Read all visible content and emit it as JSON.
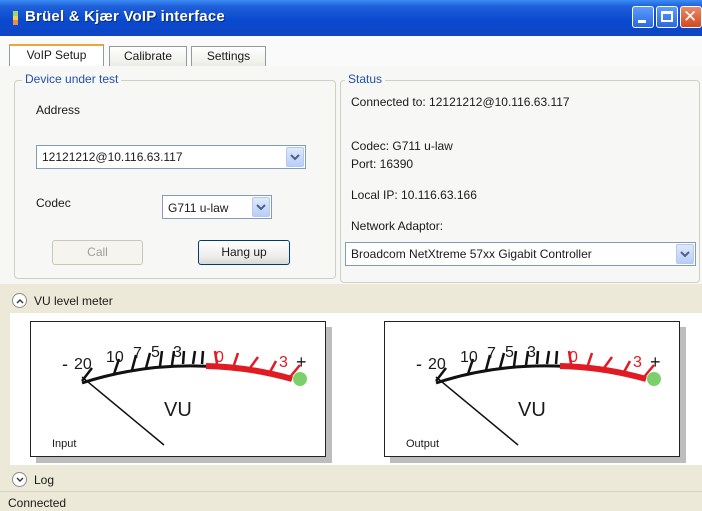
{
  "window": {
    "title": "Brüel & Kjær VoIP interface"
  },
  "tabs": [
    {
      "label": "VoIP Setup",
      "active": true
    },
    {
      "label": "Calibrate",
      "active": false
    },
    {
      "label": "Settings",
      "active": false
    }
  ],
  "device_under_test": {
    "legend": "Device under test",
    "address_label": "Address",
    "address_value": "12121212@10.116.63.117",
    "codec_label": "Codec",
    "codec_value": "G711 u-law",
    "call_label": "Call",
    "hangup_label": "Hang up"
  },
  "status": {
    "legend": "Status",
    "connected_to": "Connected to:  12121212@10.116.63.117",
    "codec": "Codec:  G711 u-law",
    "port": "Port:  16390",
    "local_ip": "Local IP:  10.116.63.166",
    "network_adaptor_label": "Network Adaptor:",
    "network_adaptor_value": "Broadcom NetXtreme 57xx Gigabit Controller"
  },
  "vu_section": {
    "label": "VU level meter",
    "expanded": true
  },
  "meters": [
    {
      "label": "Input"
    },
    {
      "label": "Output"
    }
  ],
  "meter_scale": {
    "minus_sign": "-",
    "plus_sign": "+",
    "ticks": [
      "20",
      "10",
      "7",
      "5",
      "3",
      "0",
      "3"
    ],
    "unit": "VU",
    "colors": {
      "normal": "#1a1a1a",
      "over": "#e01b24",
      "led": "#7ccf6b"
    }
  },
  "log_section": {
    "label": "Log",
    "expanded": false
  },
  "statusbar": {
    "text": "Connected"
  }
}
